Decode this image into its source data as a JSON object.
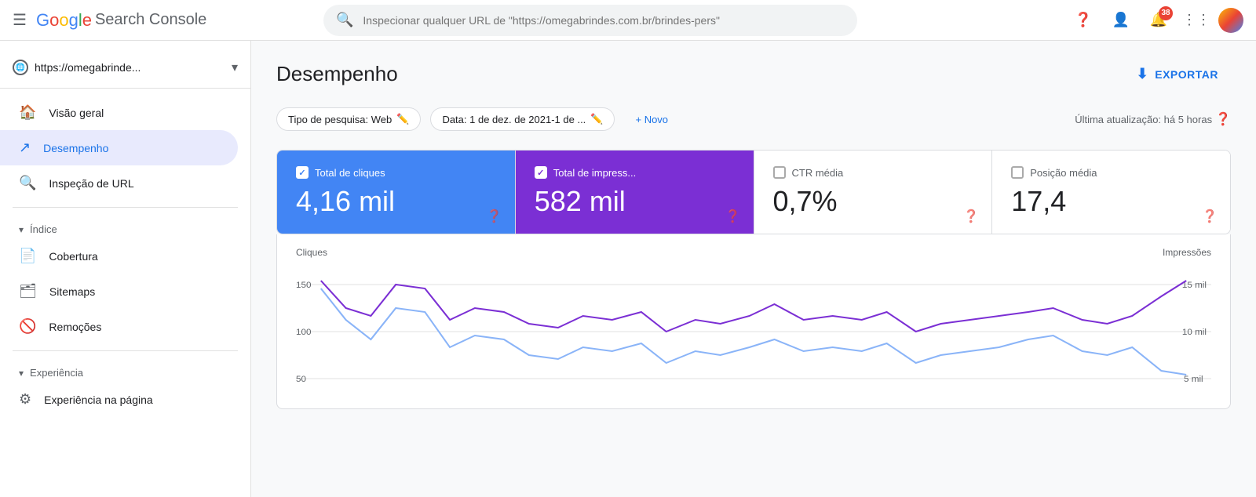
{
  "topbar": {
    "logo": {
      "google": "Google",
      "product": "Search Console"
    },
    "search_placeholder": "Inspecionar qualquer URL de \"https://omegabrindes.com.br/brindes-pers\"",
    "notification_count": "38"
  },
  "sidebar": {
    "site_url": "https://omegabrinde...",
    "nav": [
      {
        "id": "overview",
        "label": "Visão geral",
        "icon": "🏠",
        "active": false
      },
      {
        "id": "performance",
        "label": "Desempenho",
        "icon": "↗",
        "active": true
      },
      {
        "id": "url-inspection",
        "label": "Inspeção de URL",
        "icon": "🔍",
        "active": false
      }
    ],
    "sections": [
      {
        "id": "index",
        "label": "Índice",
        "items": [
          {
            "id": "coverage",
            "label": "Cobertura",
            "icon": "📄"
          },
          {
            "id": "sitemaps",
            "label": "Sitemaps",
            "icon": "🗂"
          },
          {
            "id": "removals",
            "label": "Remoções",
            "icon": "🚫"
          }
        ]
      },
      {
        "id": "experience",
        "label": "Experiência",
        "items": [
          {
            "id": "page-experience",
            "label": "Experiência na página",
            "icon": "⚙"
          }
        ]
      }
    ]
  },
  "content": {
    "title": "Desempenho",
    "export_label": "EXPORTAR",
    "filters": {
      "search_type": "Tipo de pesquisa: Web",
      "date_range": "Data: 1 de dez. de 2021-1 de ...",
      "add_new": "+ Novo"
    },
    "last_update": "Última atualização: há 5 horas",
    "metrics": [
      {
        "id": "clicks",
        "label": "Total de cliques",
        "value": "4,16 mil",
        "checked": true,
        "type": "blue"
      },
      {
        "id": "impressions",
        "label": "Total de impress...",
        "value": "582 mil",
        "checked": true,
        "type": "purple"
      },
      {
        "id": "ctr",
        "label": "CTR média",
        "value": "0,7%",
        "checked": false,
        "type": "white"
      },
      {
        "id": "position",
        "label": "Posição média",
        "value": "17,4",
        "checked": false,
        "type": "white"
      }
    ],
    "chart": {
      "y_label_left": "Cliques",
      "y_label_right": "Impressões",
      "y_ticks_left": [
        "150",
        "100",
        "50"
      ],
      "y_ticks_right": [
        "15 mil",
        "10 mil",
        "5 mil"
      ]
    }
  }
}
